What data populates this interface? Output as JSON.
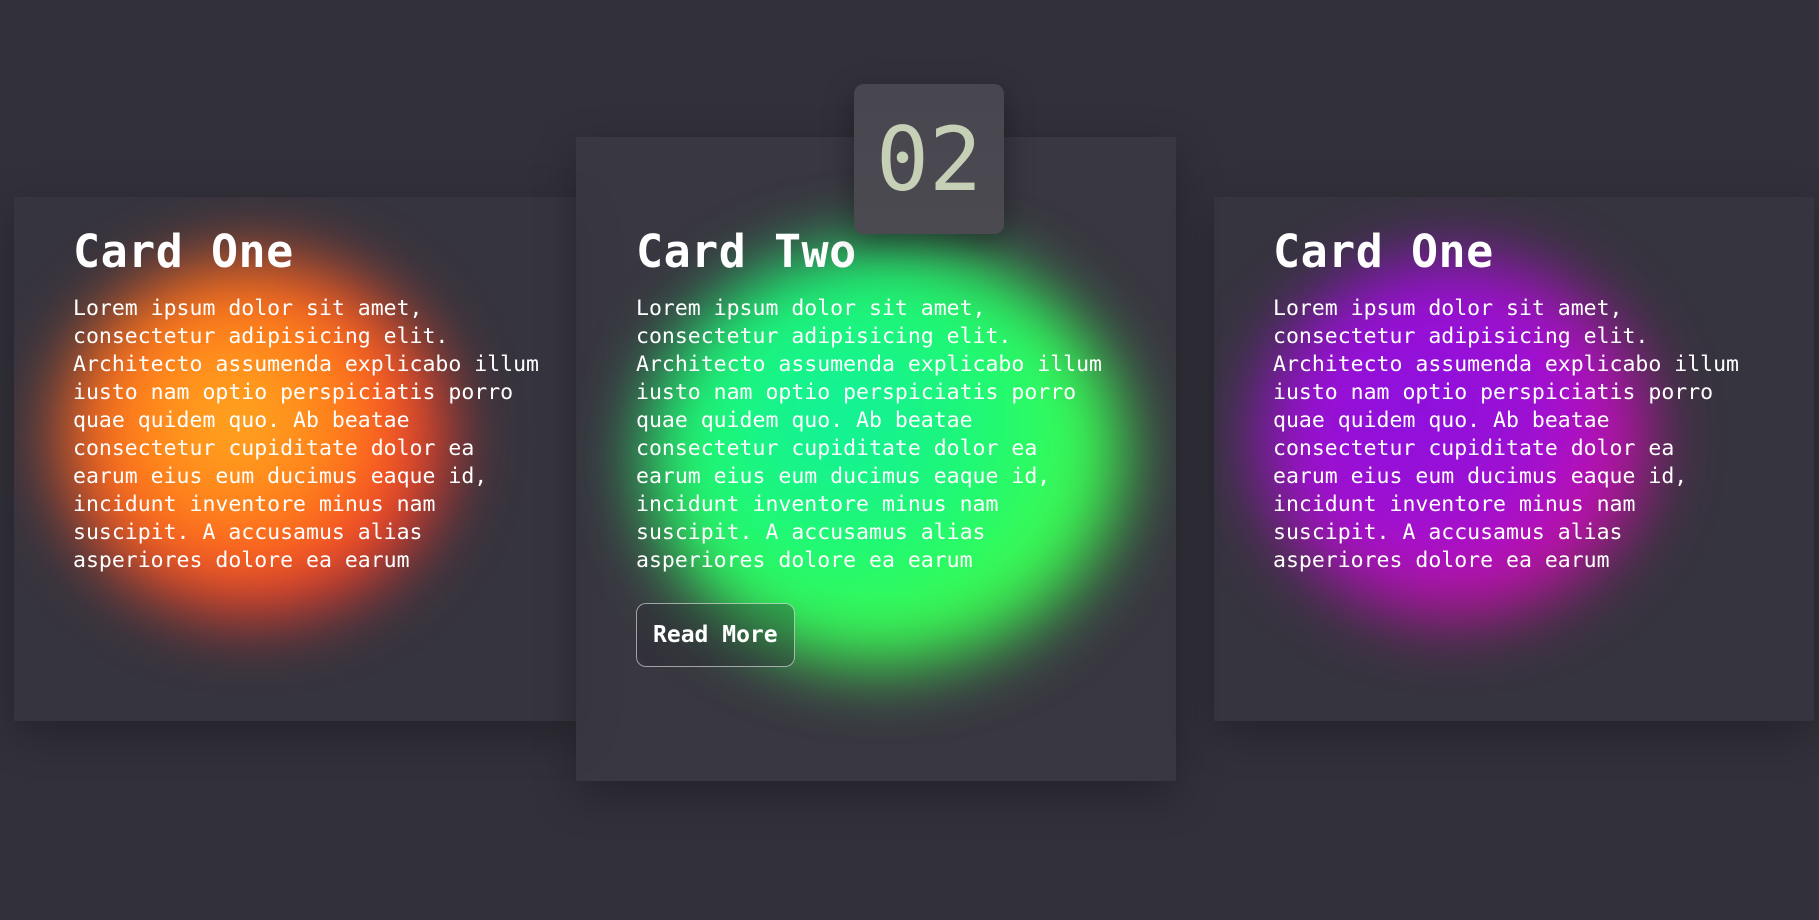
{
  "badge": {
    "number": "02"
  },
  "cards": [
    {
      "title": "Card One",
      "text": "Lorem ipsum dolor sit amet,\nconsectetur adipisicing elit.\nArchitecto assumenda explicabo illum\niusto nam optio perspiciatis porro\nquae quidem quo. Ab beatae\nconsectetur cupiditate dolor ea\nearum eius eum ducimus eaque id,\nincidunt inventore minus nam\nsuscipit. A accusamus alias\nasperiores dolore ea earum",
      "glow_colors": [
        "#ffb020",
        "#ff7a1a",
        "#f03030"
      ]
    },
    {
      "title": "Card Two",
      "text": "Lorem ipsum dolor sit amet,\nconsectetur adipisicing elit.\nArchitecto assumenda explicabo illum\niusto nam optio perspiciatis porro\nquae quidem quo. Ab beatae\nconsectetur cupiditate dolor ea\nearum eius eum ducimus eaque id,\nincidunt inventore minus nam\nsuscipit. A accusamus alias\nasperiores dolore ea earum",
      "button_label": "Read More",
      "glow_colors": [
        "#10f0a0",
        "#20f870",
        "#40ff50"
      ]
    },
    {
      "title": "Card One",
      "text": "Lorem ipsum dolor sit amet,\nconsectetur adipisicing elit.\nArchitecto assumenda explicabo illum\niusto nam optio perspiciatis porro\nquae quidem quo. Ab beatae\nconsectetur cupiditate dolor ea\nearum eius eum ducimus eaque id,\nincidunt inventore minus nam\nsuscipit. A accusamus alias\nasperiores dolore ea earum",
      "glow_colors": [
        "#8a10e0",
        "#a010d0",
        "#d010a0"
      ]
    }
  ],
  "colors": {
    "background": "#32303a",
    "badge_text": "#c6d0b6",
    "text": "#ffffff"
  }
}
